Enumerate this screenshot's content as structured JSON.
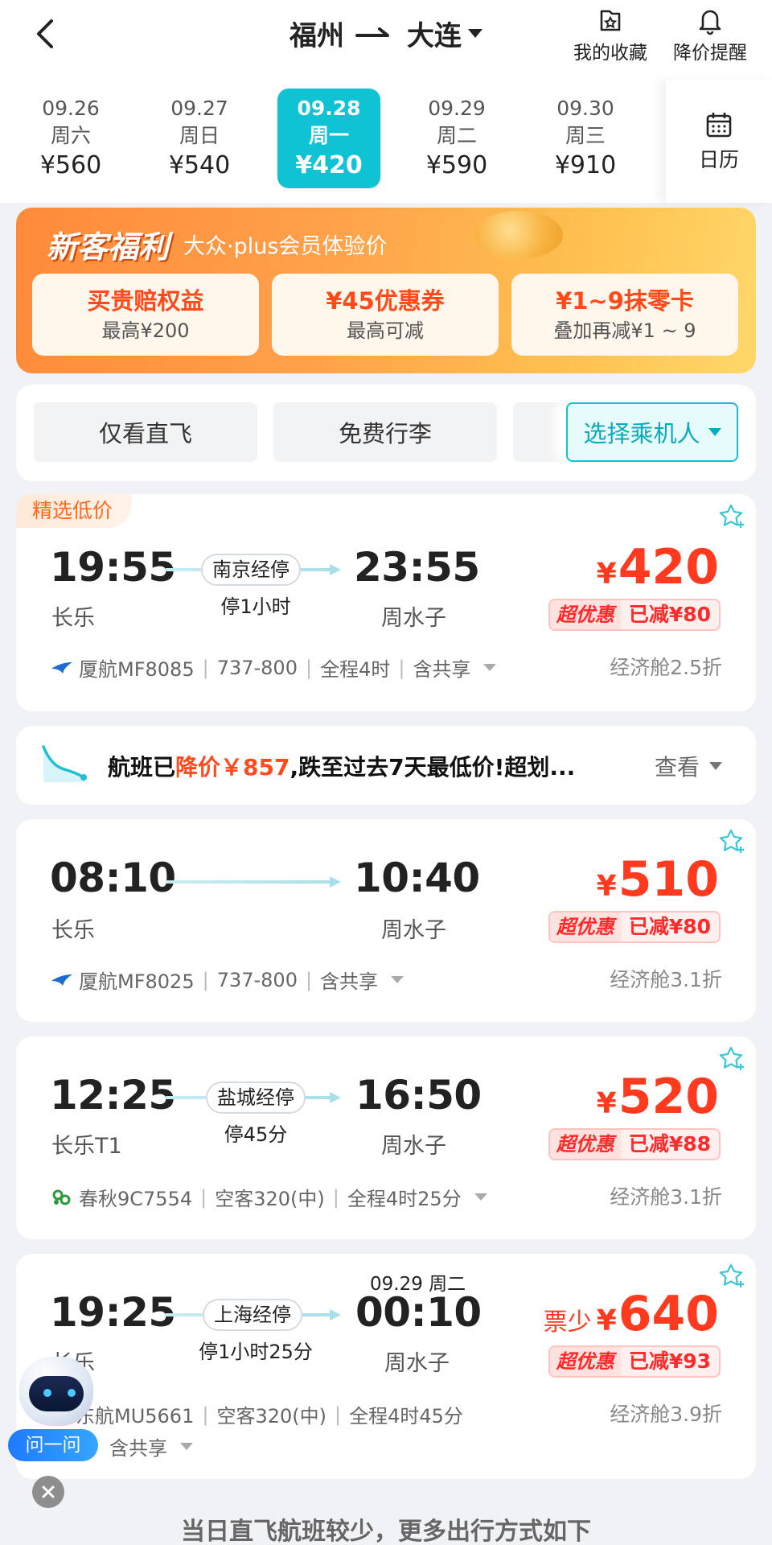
{
  "header": {
    "origin": "福州",
    "destination": "大连",
    "favorites_label": "我的收藏",
    "price_alert_label": "降价提醒"
  },
  "dates": [
    {
      "date": "09.26",
      "weekday": "周六",
      "price": "¥560"
    },
    {
      "date": "09.27",
      "weekday": "周日",
      "price": "¥540"
    },
    {
      "date": "09.28",
      "weekday": "周一",
      "price": "¥420",
      "selected": true
    },
    {
      "date": "09.29",
      "weekday": "周二",
      "price": "¥590"
    },
    {
      "date": "09.30",
      "weekday": "周三",
      "price": "¥910"
    }
  ],
  "calendar_label": "日历",
  "promo": {
    "title": "新客福利",
    "subtitle": "大众·plus会员体验价",
    "cards": [
      {
        "title": "买贵赔权益",
        "sub": "最高¥200"
      },
      {
        "title": "¥45优惠券",
        "sub": "最高可减"
      },
      {
        "title": "¥1~9抹零卡",
        "sub": "叠加再减¥1 ~ 9"
      }
    ]
  },
  "filters": {
    "direct_only": "仅看直飞",
    "free_baggage": "免费行李",
    "select_passenger": "选择乘机人"
  },
  "flights": [
    {
      "badge": "精选低价",
      "dep_time": "19:55",
      "dep_airport": "长乐",
      "arr_time": "23:55",
      "arr_airport": "周水子",
      "stop": "南京经停",
      "stop_duration": "停1小时",
      "price": "420",
      "discount_tag": "超优惠",
      "discount_amount": "已减¥80",
      "airline": "厦航MF8085",
      "aircraft": "737-800",
      "duration": "全程4时",
      "share": "含共享",
      "cabin": "经济舱2.5折"
    },
    {
      "dep_time": "08:10",
      "dep_airport": "长乐",
      "arr_time": "10:40",
      "arr_airport": "周水子",
      "price": "510",
      "discount_tag": "超优惠",
      "discount_amount": "已减¥80",
      "airline": "厦航MF8025",
      "aircraft": "737-800",
      "share": "含共享",
      "cabin": "经济舱3.1折"
    },
    {
      "dep_time": "12:25",
      "dep_airport": "长乐T1",
      "arr_time": "16:50",
      "arr_airport": "周水子",
      "stop": "盐城经停",
      "stop_duration": "停45分",
      "price": "520",
      "discount_tag": "超优惠",
      "discount_amount": "已减¥88",
      "airline": "春秋9C7554",
      "aircraft": "空客320(中)",
      "duration": "全程4时25分",
      "cabin": "经济舱3.1折"
    },
    {
      "next_day": "09.29 周二",
      "dep_time": "19:25",
      "dep_airport": "长乐",
      "arr_time": "00:10",
      "arr_airport": "周水子",
      "stop": "上海经停",
      "stop_duration": "停1小时25分",
      "low_stock": "票少",
      "price": "640",
      "discount_tag": "超优惠",
      "discount_amount": "已减¥93",
      "airline": "东航MU5661",
      "aircraft": "空客320(中)",
      "duration": "全程4时45分",
      "share": "含共享",
      "cabin": "经济舱3.9折"
    }
  ],
  "price_drop": {
    "prefix": "航班已",
    "highlight": "降价￥857",
    "suffix": ",跌至过去7天最低价!超划...",
    "view": "查看"
  },
  "currency_symbol": "¥",
  "assistant_label": "问一问",
  "bottom_note": "当日直飞航班较少，更多出行方式如下"
}
